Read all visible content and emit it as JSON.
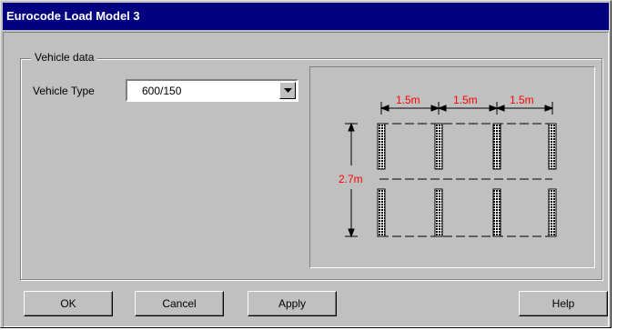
{
  "window": {
    "title": "Eurocode Load Model 3"
  },
  "group": {
    "label": "Vehicle data",
    "vehicle_type_label": "Vehicle Type",
    "vehicle_type_value": "600/150"
  },
  "diagram": {
    "spacing_labels": [
      "1.5m",
      "1.5m",
      "1.5m"
    ],
    "width_label": "2.7m"
  },
  "buttons": {
    "ok": "OK",
    "cancel": "Cancel",
    "apply": "Apply",
    "help": "Help"
  },
  "colors": {
    "titlebar": "#000080",
    "dimension_text": "#ff0000",
    "face": "#c0c0c0"
  }
}
